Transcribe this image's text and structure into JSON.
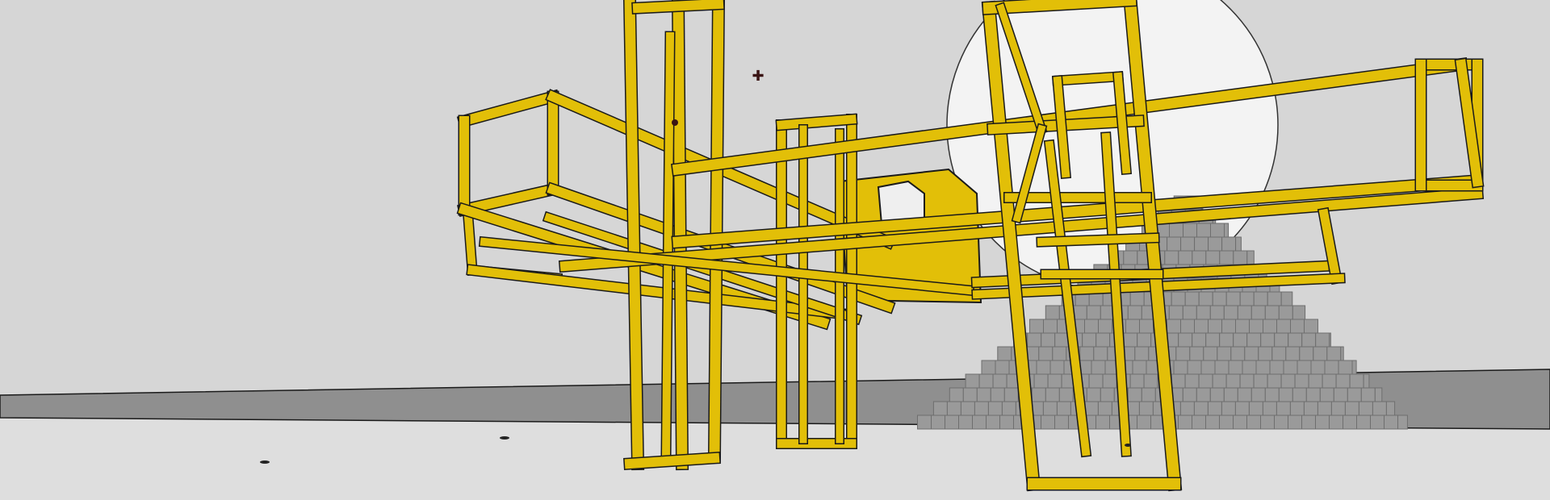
{
  "scene": {
    "name": "voxel-construction-view",
    "colors": {
      "sky": "#d9d9d9",
      "ground": "#dcdcdc",
      "ground_strip": "#8f8f8f",
      "sun": "#f2f2f2",
      "frame": "#e2bf08",
      "frame_dark": "#b39300",
      "outline": "#1a1a1a",
      "pyramid": "#9a9a9a",
      "pyramid_dark": "#6e6e6e",
      "block_white": "#efefef"
    },
    "objects": [
      {
        "type": "yellow-lattice-structure"
      },
      {
        "type": "stepped-pyramid"
      },
      {
        "type": "sun-disc"
      },
      {
        "type": "ground-strip"
      }
    ]
  },
  "hud": {
    "crosshair_icon": "crosshair-icon",
    "crosshair_glyph": "✚"
  }
}
